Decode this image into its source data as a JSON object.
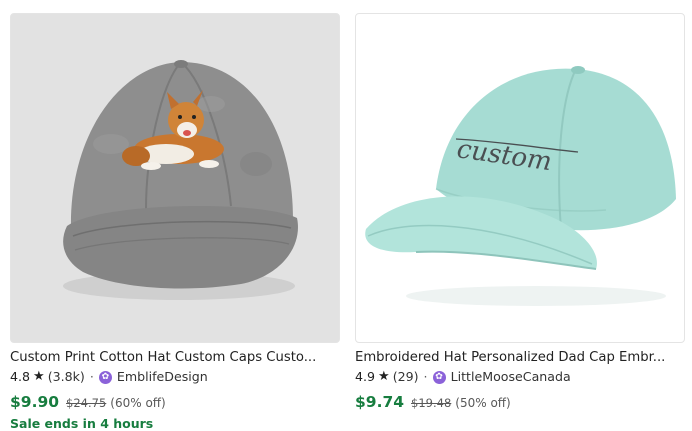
{
  "listings": [
    {
      "title": "Custom Print Cotton Hat Custom Caps Custo...",
      "rating": "4.8",
      "star_icon": "★",
      "review_count": "(3.8k)",
      "separator": "·",
      "shop_badge_icon": "✿",
      "shop_name": "EmblifeDesign",
      "price": "$9.90",
      "original_price": "$24.75",
      "discount": "(60% off)",
      "sale_text": "Sale ends in 4 hours",
      "image_desc_colors": {
        "cap": "#8e8e8e",
        "background": "#e2e2e2"
      }
    },
    {
      "title": "Embroidered Hat Personalized Dad Cap Embr...",
      "rating": "4.9",
      "star_icon": "★",
      "review_count": "(29)",
      "separator": "·",
      "shop_badge_icon": "✿",
      "shop_name": "LittleMooseCanada",
      "price": "$9.74",
      "original_price": "$19.48",
      "discount": "(50% off)",
      "embroidery_text": "custom",
      "image_desc_colors": {
        "cap": "#a6dcd3",
        "background": "#ffffff"
      }
    }
  ],
  "colors": {
    "price_green": "#177d3f",
    "shop_badge_purple": "#8b62d9",
    "text": "#222222",
    "muted": "#595959"
  }
}
